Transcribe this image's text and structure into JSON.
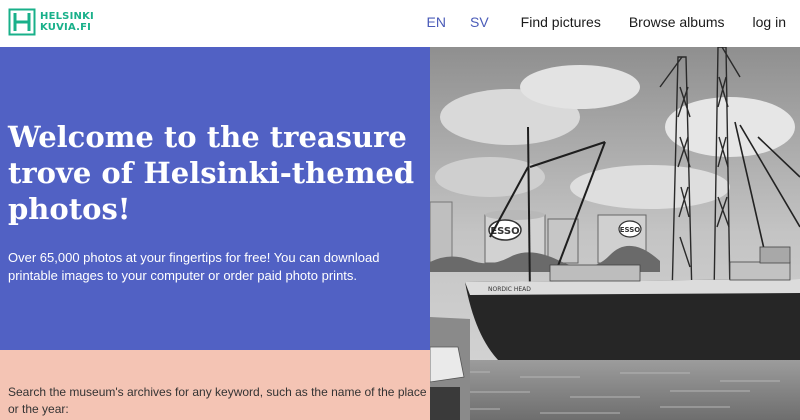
{
  "header": {
    "logo_line1": "HELSINKI",
    "logo_line2": "KUVIA.FI",
    "logo_icon": "helsinki-logo-mark",
    "lang_en": "EN",
    "lang_sv": "SV",
    "find_pictures": "Find pictures",
    "browse_albums": "Browse albums",
    "login": "log in"
  },
  "hero": {
    "title": "Welcome to the treasure trove of Helsinki-themed photos!",
    "subtitle": "Over 65,000 photos at your fingertips for free! You can download printable images to your computer or order paid photo prints."
  },
  "search": {
    "prompt": "Search the museum's archives for any keyword, such as the name of the place or the year:"
  },
  "photo": {
    "tank_label": "ESSO",
    "ship_name": "NORDIC HEAD"
  },
  "colors": {
    "brand_green": "#19b08a",
    "hero_blue": "#5161c4",
    "search_salmon": "#f4c4b4",
    "lang_blue": "#4a5bb8"
  }
}
